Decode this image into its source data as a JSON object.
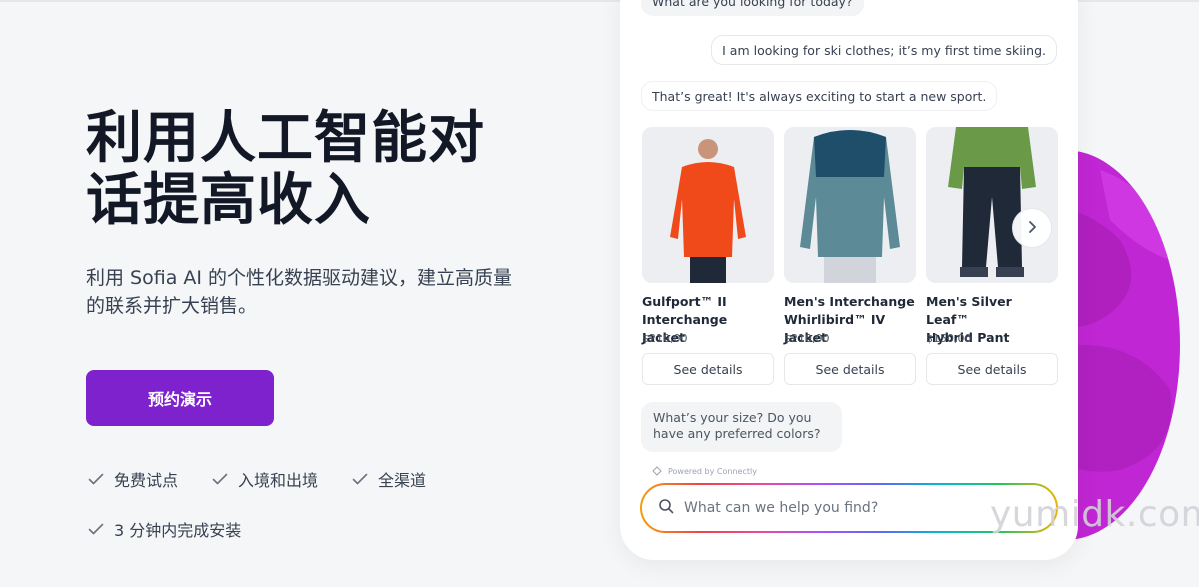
{
  "hero": {
    "title_line1": "利用人工智能对",
    "title_line2": "话提高收入",
    "subtitle": "利用 Sofia AI 的个性化数据驱动建议，建立高质量的联系并扩大销售。",
    "cta_label": "预约演示",
    "features": [
      "免费试点",
      "入境和出境",
      "全渠道",
      "3 分钟内完成安装"
    ]
  },
  "chat": {
    "messages": [
      {
        "role": "bot",
        "text": "What are you looking for today?"
      },
      {
        "role": "user",
        "text": "I am looking for ski clothes; it’s my first time skiing."
      },
      {
        "role": "bot",
        "text": "That’s great! It's always exciting to start a new sport."
      }
    ],
    "products": [
      {
        "name_line1": "Gulfport™ II",
        "name_line2": "Interchange Jacket",
        "price": "$210,00",
        "button": "See details",
        "color": "#f04a1a"
      },
      {
        "name_line1": "Men's Interchange",
        "name_line2": "Whirlibird™ IV Jacket",
        "price": "$210,00",
        "button": "See details",
        "color": "#5c8a96"
      },
      {
        "name_line1": "Men's Silver Leaf™",
        "name_line2": "Hybrid Pant",
        "price": "$150,00",
        "button": "See details",
        "color": "#6a9a48"
      }
    ],
    "question": "What’s your size? Do you have any preferred colors?",
    "powered_by": "Powered by Connectly",
    "search_placeholder": "What can we help you find?"
  },
  "watermark": "yumidk.com",
  "colors": {
    "accent": "#7e22ce",
    "blob": "#c026d3"
  },
  "icons": [
    "check-icon",
    "chevron-right-icon",
    "search-icon",
    "connectly-logo-icon"
  ]
}
